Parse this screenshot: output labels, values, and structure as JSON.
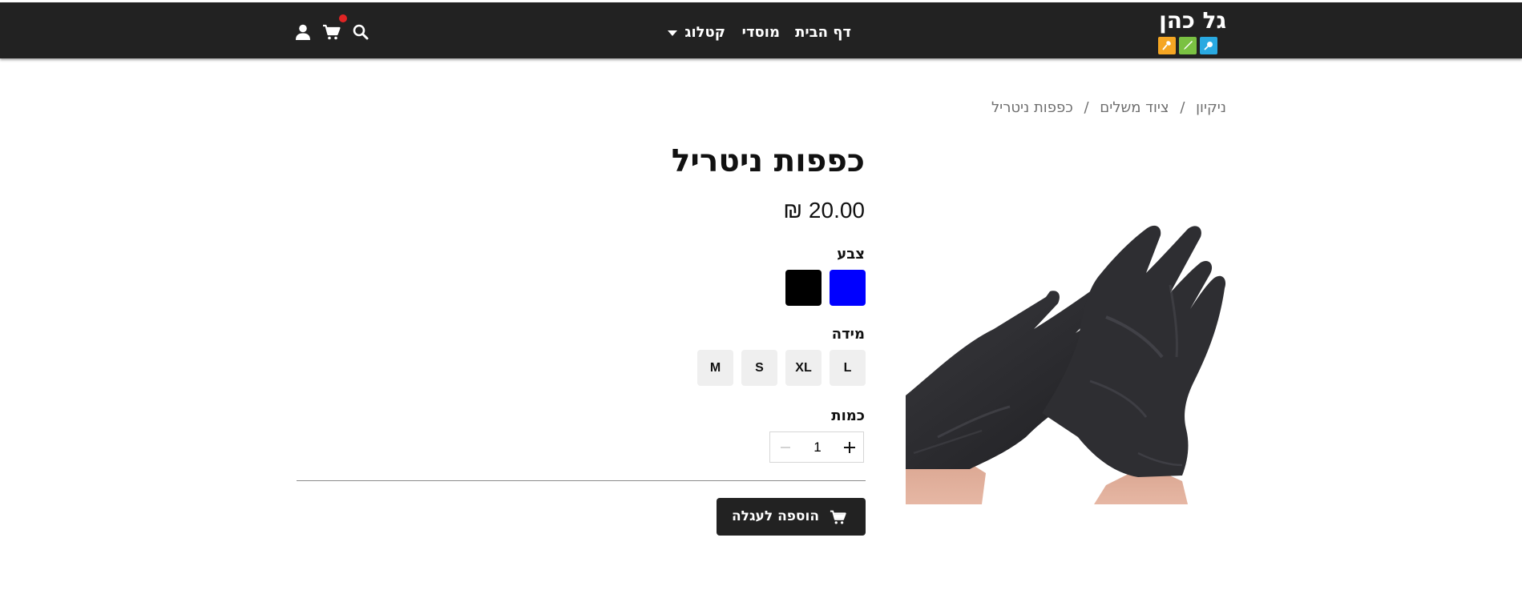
{
  "header": {
    "logo_text": "גל כהן",
    "nav": {
      "home": "דף הבית",
      "institutions": "מוסדי",
      "catalog": "קטלוג"
    }
  },
  "breadcrumb": {
    "items": [
      "ניקיון",
      "ציוד משלים",
      "כפפות ניטריל"
    ],
    "separator": "/"
  },
  "product": {
    "title": "כפפות ניטריל",
    "price": "20.00 ₪",
    "color_label": "צבע",
    "colors": [
      {
        "name": "blue",
        "hex": "#0000ff"
      },
      {
        "name": "black",
        "hex": "#000000"
      }
    ],
    "size_label": "מידה",
    "sizes": [
      "L",
      "XL",
      "S",
      "M"
    ],
    "quantity_label": "כמות",
    "quantity_value": "1",
    "add_to_cart_label": "הוספה לעגלה"
  },
  "colors": {
    "header_bg": "#222222",
    "breadcrumb_text": "#6f6f6f",
    "cart_badge": "#e02424",
    "logo_tiles": [
      "#f5a623",
      "#7ac142",
      "#29a9e1"
    ]
  },
  "icons": {
    "header": [
      "search-icon",
      "cart-icon",
      "user-icon"
    ],
    "logo_tiles": [
      "spoon-icon",
      "knife-icon",
      "brush-icon"
    ],
    "quantity": [
      "minus-icon",
      "plus-icon"
    ],
    "add_to_cart": "cart-icon"
  }
}
